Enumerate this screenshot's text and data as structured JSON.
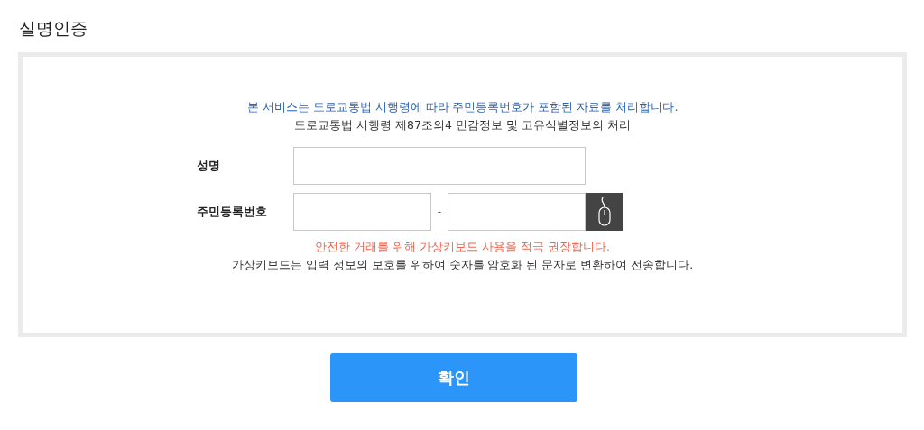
{
  "title": "실명인증",
  "notices": [
    {
      "kind": "info",
      "text": "본 서비스는 도로교통법 시행령에 따라 주민등록번호가 포함된 자료를 처리합니다."
    },
    {
      "kind": "plain",
      "text": "도로교통법 시행령 제87조의4 민감정보 및 고유식별정보의 처리"
    }
  ],
  "name_field": {
    "label": "성명"
  },
  "id_field": {
    "label": "주민등록번호",
    "separator": "-"
  },
  "warnings": [
    {
      "kind": "alert",
      "text": "안전한 거래를 위해 가상키보드 사용을 적극 권장합니다."
    },
    {
      "kind": "plain",
      "text": "가상키보드는 입력 정보의 보호를 위하여 숫자를 암호화 된 문자로 변환하여 전송합니다."
    }
  ],
  "confirm_button": "확인"
}
